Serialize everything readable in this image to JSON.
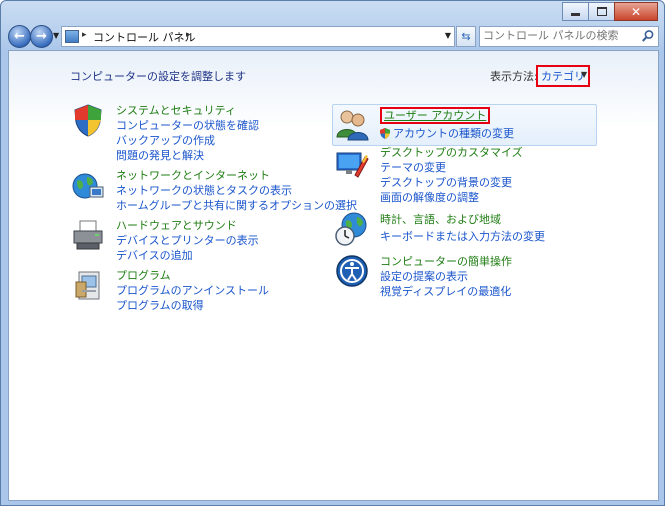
{
  "window": {
    "caption_buttons": [
      "minimize",
      "maximize",
      "close"
    ]
  },
  "navigation": {
    "back_icon": "back-arrow-icon",
    "forward_icon": "forward-arrow-icon",
    "address_crumb": "コントロール パネル",
    "search_placeholder": "コントロール パネルの検索"
  },
  "header": {
    "title": "コンピューターの設定を調整します",
    "view_by_label": "表示方法:",
    "view_by_value": "カテゴリ"
  },
  "categories_left": [
    {
      "icon": "shield-icon",
      "title": "システムとセキュリティ",
      "links": [
        "コンピューターの状態を確認",
        "バックアップの作成",
        "問題の発見と解決"
      ]
    },
    {
      "icon": "network-globe-icon",
      "title": "ネットワークとインターネット",
      "links": [
        "ネットワークの状態とタスクの表示",
        "ホームグループと共有に関するオプションの選択"
      ]
    },
    {
      "icon": "printer-icon",
      "title": "ハードウェアとサウンド",
      "links": [
        "デバイスとプリンターの表示",
        "デバイスの追加"
      ]
    },
    {
      "icon": "programs-icon",
      "title": "プログラム",
      "links": [
        "プログラムのアンインストール",
        "プログラムの取得"
      ]
    }
  ],
  "categories_right": [
    {
      "icon": "user-accounts-icon",
      "title": "ユーザー アカウント",
      "links": [
        "アカウントの種類の変更"
      ]
    },
    {
      "icon": "appearance-icon",
      "title": "デスクトップのカスタマイズ",
      "links": [
        "テーマの変更",
        "デスクトップの背景の変更",
        "画面の解像度の調整"
      ]
    },
    {
      "icon": "clock-globe-icon",
      "title": "時計、言語、および地域",
      "links": [
        "キーボードまたは入力方法の変更"
      ]
    },
    {
      "icon": "ease-of-access-icon",
      "title": "コンピューターの簡単操作",
      "links": [
        "設定の提案の表示",
        "視覚ディスプレイの最適化"
      ]
    }
  ],
  "colors": {
    "link": "#1a55cc",
    "category_title": "#1e7d12",
    "highlight_border": "#e60012"
  }
}
